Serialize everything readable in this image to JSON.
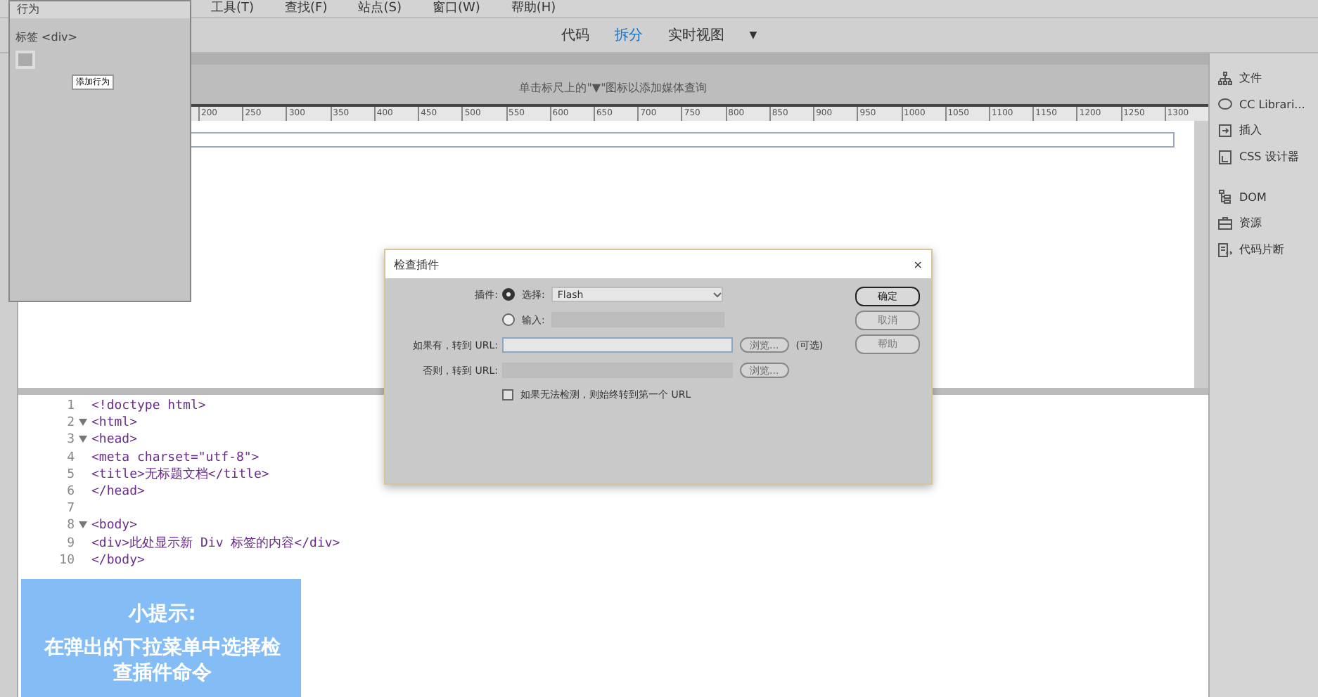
{
  "menu_bar": {
    "items": [
      "工具(T)",
      "查找(F)",
      "站点(S)",
      "窗口(W)",
      "帮助(H)"
    ]
  },
  "view_bar": {
    "tabs": [
      {
        "label": "代码",
        "selected": false
      },
      {
        "label": "拆分",
        "selected": true
      },
      {
        "label": "实时视图",
        "selected": false
      }
    ],
    "dropdown": "▼"
  },
  "media_query_bar": {
    "text": "单击标尺上的\"▼\"图标以添加媒体查询"
  },
  "ruler": {
    "labels": [
      "200",
      "250",
      "300",
      "350",
      "400",
      "450",
      "500",
      "550",
      "600",
      "650",
      "700",
      "750",
      "800",
      "850",
      "900",
      "950",
      "1000",
      "1050",
      "1100",
      "1150",
      "1200",
      "1250",
      "1300"
    ]
  },
  "behaviors_panel": {
    "title": "行为",
    "tag_label": "标签 <div>",
    "tooltip": "添加行为"
  },
  "code_view": {
    "lines": [
      {
        "number": "1",
        "foldable": false,
        "code": "<!doctype html>"
      },
      {
        "number": "2",
        "foldable": true,
        "code": "<html>"
      },
      {
        "number": "3",
        "foldable": true,
        "code": "<head>"
      },
      {
        "number": "4",
        "foldable": false,
        "code": "<meta charset=\"utf-8\">"
      },
      {
        "number": "5",
        "foldable": false,
        "code": "<title>无标题文档</title>"
      },
      {
        "number": "6",
        "foldable": false,
        "code": "</head>"
      },
      {
        "number": "7",
        "foldable": false
      },
      {
        "number": "8",
        "foldable": true,
        "code": "<body>"
      },
      {
        "number": "9",
        "foldable": false,
        "code": "<div>此处显示新 Div 标签的内容</div>"
      },
      {
        "number": "10",
        "foldable": false,
        "code": "</body>"
      }
    ]
  },
  "right_panel": {
    "items": [
      {
        "label": "文件",
        "kind": "files"
      },
      {
        "label": "CC Librari...",
        "kind": "libraries"
      },
      {
        "label": "插入",
        "kind": "insert"
      },
      {
        "label": "CSS 设计器",
        "kind": "css"
      },
      {
        "label": "DOM",
        "kind": "dom"
      },
      {
        "label": "资源",
        "kind": "assets"
      },
      {
        "label": "代码片断",
        "kind": "snippets"
      }
    ]
  },
  "dialog": {
    "title": "检查插件",
    "close": "×",
    "plugin_label": "插件:",
    "radio_options": [
      {
        "label": "选择:",
        "selected": true
      },
      {
        "label": "输入:",
        "selected": false
      }
    ],
    "select_value": "Flash",
    "if_found_label": "如果有，转到 URL:",
    "browse_1": "浏览...",
    "optional": "(可选)",
    "otherwise_label": "否则，转到 URL:",
    "browse_2": "浏览...",
    "checkbox": {
      "label": "如果无法检测，则始终转到第一个 URL",
      "checked": false
    },
    "buttons": [
      {
        "label": "确定",
        "primary": true
      },
      {
        "label": "取消",
        "primary": false
      },
      {
        "label": "帮助",
        "primary": false
      }
    ]
  },
  "tip": {
    "title": "小提示:",
    "text": "在弹出的下拉菜单中选择检查插件命令"
  }
}
